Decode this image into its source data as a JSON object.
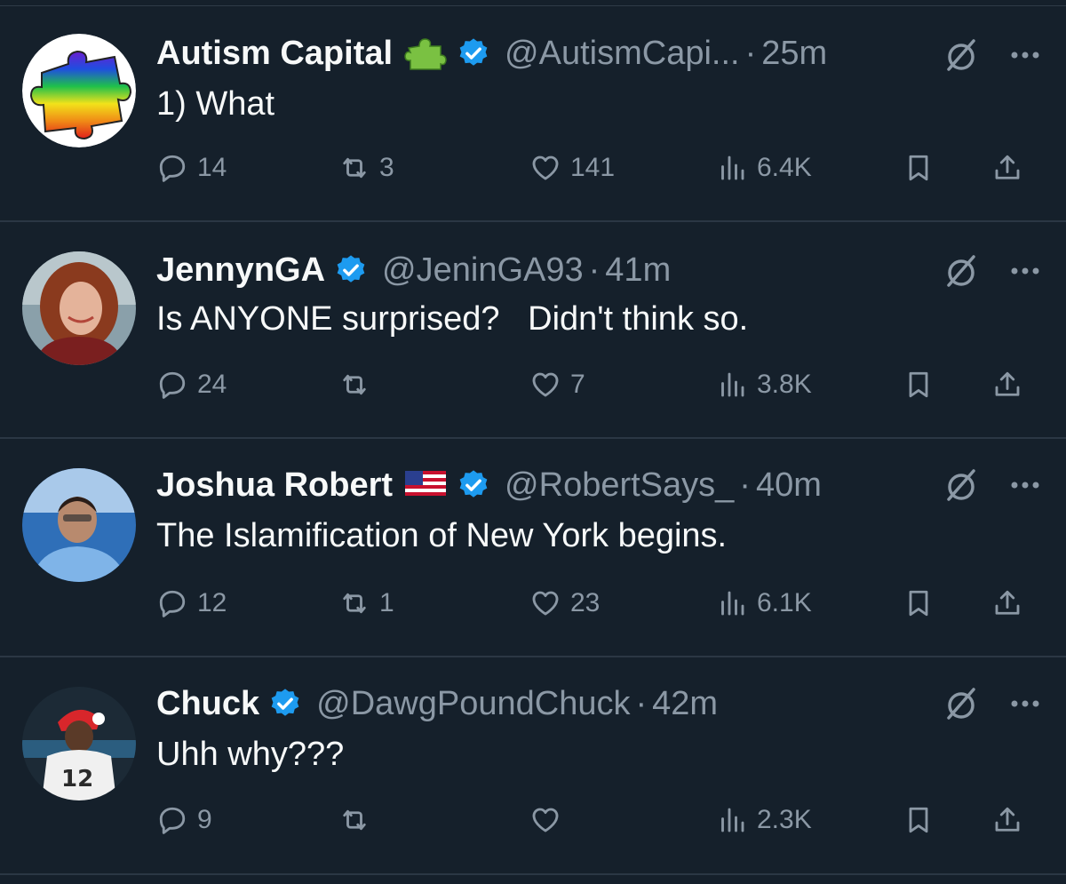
{
  "tweets": [
    {
      "name": "Autism Capital",
      "name_emoji": "puzzle-piece",
      "verified": true,
      "handle": "@AutismCapi...",
      "dot": "·",
      "time": "25m",
      "text": "1) What",
      "replies": "14",
      "reposts": "3",
      "likes": "141",
      "views": "6.4K"
    },
    {
      "name": "JennynGA",
      "verified": true,
      "handle": "@JeninGA93",
      "dot": "·",
      "time": "41m",
      "text": "Is ANYONE surprised?   Didn't think so.",
      "replies": "24",
      "reposts": "",
      "likes": "7",
      "views": "3.8K"
    },
    {
      "name": "Joshua Robert",
      "name_emoji": "us-flag",
      "verified": true,
      "handle": "@RobertSays_",
      "dot": "·",
      "time": "40m",
      "text": "The Islamification of New York begins.",
      "replies": "12",
      "reposts": "1",
      "likes": "23",
      "views": "6.1K"
    },
    {
      "name": "Chuck",
      "verified": true,
      "handle": "@DawgPoundChuck",
      "dot": "·",
      "time": "42m",
      "text": "Uhh why???",
      "replies": "9",
      "reposts": "",
      "likes": "",
      "views": "2.3K",
      "avatar_jersey_number": "12"
    }
  ],
  "colors": {
    "background": "#15202b",
    "text_primary": "#f7f9f9",
    "text_secondary": "#8b98a5",
    "verified_blue": "#1d9bf0",
    "divider": "#2b3744"
  }
}
